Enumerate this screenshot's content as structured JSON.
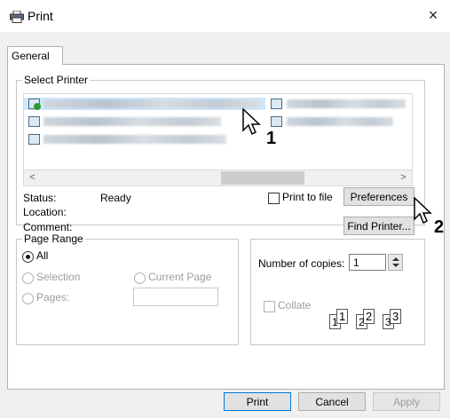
{
  "window": {
    "title": "Print",
    "close_symbol": "×"
  },
  "tab": {
    "label": "General"
  },
  "select_printer": {
    "legend": "Select Printer",
    "scroll_left": "<",
    "scroll_right": ">",
    "status_label": "Status:",
    "status_value": "Ready",
    "location_label": "Location:",
    "comment_label": "Comment:",
    "print_to_file_label": "Print to file",
    "preferences_label": "Preferences",
    "find_printer_label": "Find Printer..."
  },
  "page_range": {
    "legend": "Page Range",
    "all_label": "All",
    "selection_label": "Selection",
    "current_page_label": "Current Page",
    "pages_label": "Pages:",
    "selected": "All"
  },
  "copies": {
    "label": "Number of copies:",
    "value": "1",
    "collate_label": "Collate",
    "collate_pages": [
      "1",
      "1",
      "2",
      "2",
      "3",
      "3"
    ]
  },
  "footer": {
    "print_label": "Print",
    "cancel_label": "Cancel",
    "apply_label": "Apply"
  },
  "callouts": {
    "first": "1",
    "second": "2"
  },
  "colors": {
    "focus_border": "#0078d7",
    "selection_highlight": "#cce8ff"
  }
}
